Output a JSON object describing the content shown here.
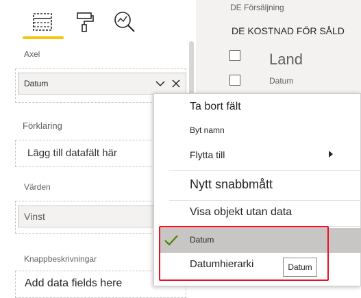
{
  "tabs": [
    {
      "icon": "table-fields-icon",
      "active": true
    },
    {
      "icon": "paint-roller-icon",
      "active": false
    },
    {
      "icon": "analytics-magnifier-icon",
      "active": false
    }
  ],
  "accent_color": "#f2c811",
  "highlight_border_color": "#e81123",
  "left": {
    "axis_label": "Axel",
    "axis_field": "Datum",
    "legend_label": "Förklaring",
    "legend_placeholder": "Lägg till datafält här",
    "values_label": "Värden",
    "values_field": "Vinst",
    "tooltips_label": "Knappbeskrivningar",
    "tooltips_placeholder": "Add data fields here"
  },
  "right": {
    "table_name": "DE Försäljning",
    "measure_name": "DE KOSTNAD FÖR SÅLD",
    "field_land": "Land",
    "field_datum": "Datum"
  },
  "menu": {
    "remove_field": "Ta bort fält",
    "rename": "Byt namn",
    "move_to": "Flytta till",
    "new_quick_measure": "Nytt snabbmått",
    "show_items_no_data": "Visa objekt utan data",
    "datum": "Datum",
    "datumhierarki": "Datumhierarki"
  },
  "tooltip_text": "Datum"
}
